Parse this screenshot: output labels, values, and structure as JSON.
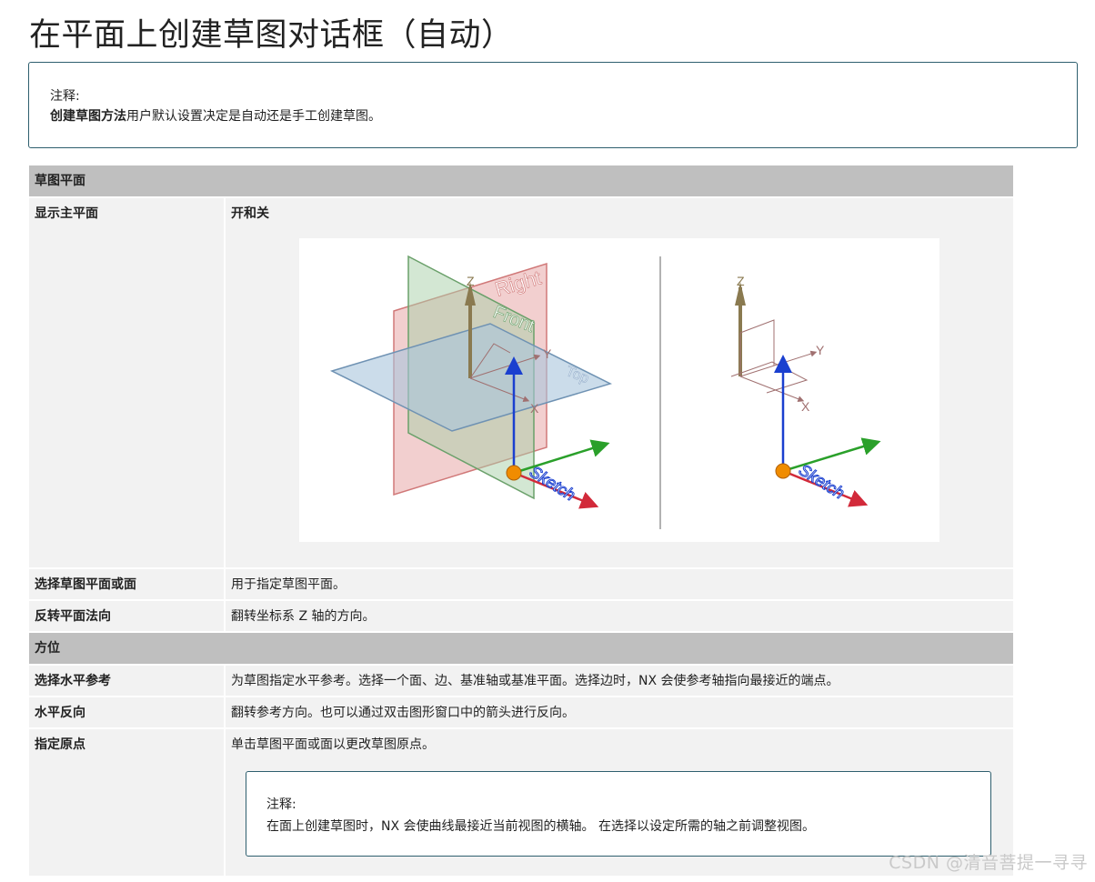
{
  "page": {
    "title": "在平面上创建草图对话框（自动）"
  },
  "top_note": {
    "label": "注释:",
    "bold_part": "创建草图方法",
    "rest": "用户默认设置决定是自动还是手工创建草图。"
  },
  "sections": [
    {
      "header": "草图平面",
      "rows": [
        {
          "key": "显示主平面",
          "value": "开和关"
        },
        {
          "key": "选择草图平面或面",
          "value": "用于指定草图平面。"
        },
        {
          "key": "反转平面法向",
          "value": "翻转坐标系 Z 轴的方向。"
        }
      ]
    },
    {
      "header": "方位",
      "rows": [
        {
          "key": "选择水平参考",
          "value": "为草图指定水平参考。选择一个面、边、基准轴或基准平面。选择边时，NX 会使参考轴指向最接近的端点。"
        },
        {
          "key": "水平反向",
          "value": "翻转参考方向。也可以通过双击图形窗口中的箭头进行反向。"
        },
        {
          "key": "指定原点",
          "value": "单击草图平面或面以更改草图原点。"
        }
      ]
    }
  ],
  "figure": {
    "plane_labels": {
      "right": "Right",
      "front": "Front",
      "top": "Top"
    },
    "axis_labels": {
      "z": "Z",
      "y": "Y",
      "x": "X"
    },
    "sketch_label": "Sketch",
    "colors": {
      "right_plane": "#e8a8a8",
      "front_plane": "#a8d0a8",
      "top_plane": "#a8c4dc",
      "sketch_z": "#1a3fcf",
      "sketch_x": "#d22a3a",
      "sketch_y": "#2aa02a",
      "origin": "#f08c00"
    }
  },
  "origin_note": {
    "label": "注释:",
    "text": "在面上创建草图时，NX 会使曲线最接近当前视图的横轴。 在选择以设定所需的轴之前调整视图。"
  },
  "watermark": "CSDN @清音菩提一寻寻"
}
